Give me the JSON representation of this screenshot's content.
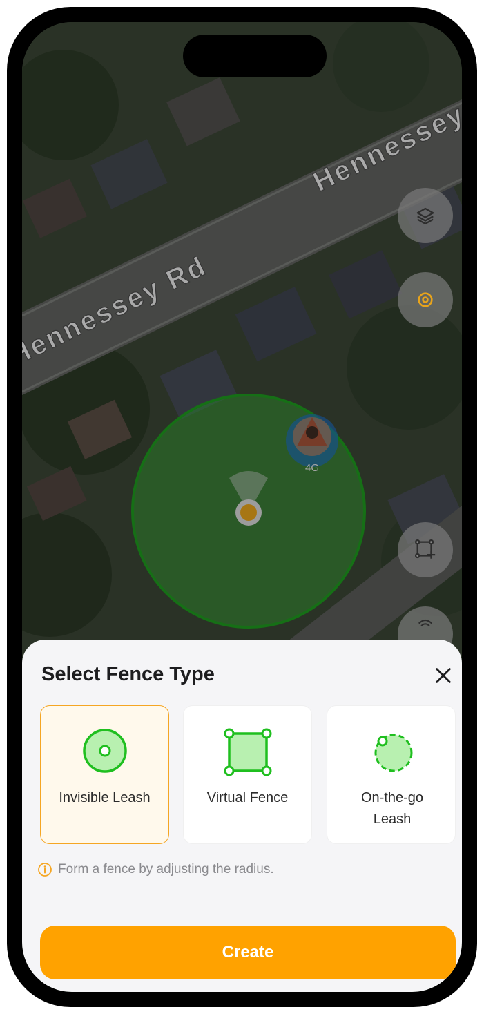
{
  "map": {
    "street_labels": [
      "Hennessey Rd",
      "Hennessey R"
    ],
    "pet_marker_badge": "4G"
  },
  "sheet": {
    "title": "Select Fence Type",
    "fence_types": [
      {
        "label": "Invisible Leash",
        "selected": true
      },
      {
        "label": "Virtual Fence",
        "selected": false
      },
      {
        "label": "On-the-go Leash",
        "selected": false
      }
    ],
    "hint": "Form a fence by adjusting the radius.",
    "create_label": "Create"
  },
  "colors": {
    "accent": "#ffa200",
    "fence_green": "#2cc22c",
    "selected_border": "#f5a623"
  },
  "icons": [
    "layers-icon",
    "locate-icon",
    "draw-fence-icon",
    "signal-icon",
    "close-icon",
    "info-icon"
  ]
}
